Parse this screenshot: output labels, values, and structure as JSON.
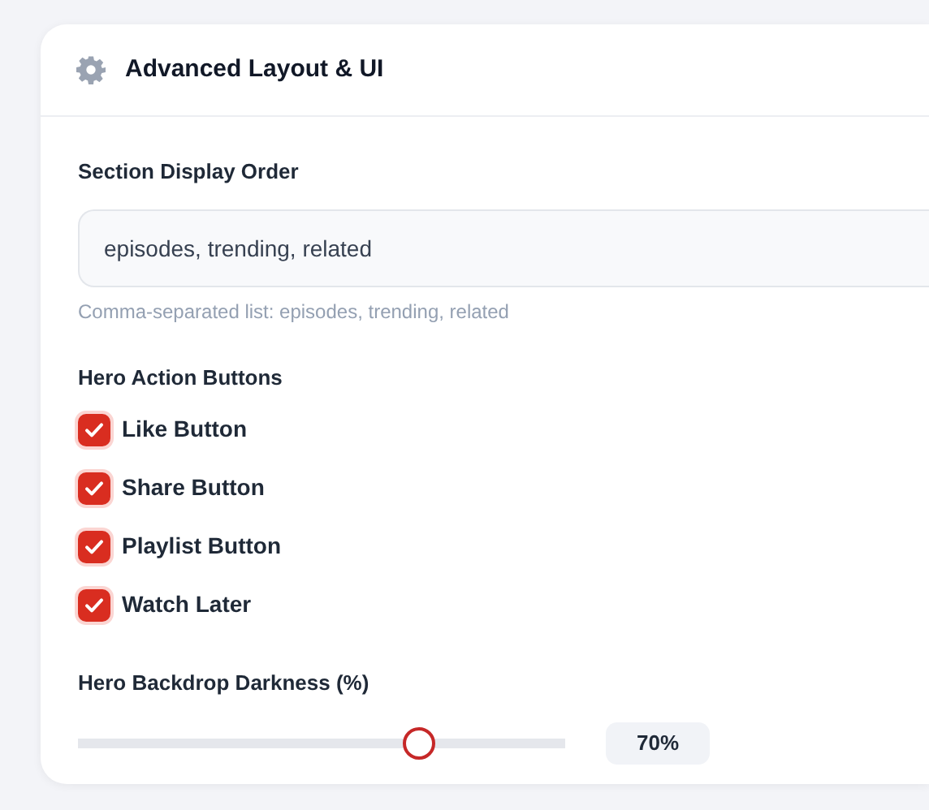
{
  "card": {
    "title": "Advanced Layout & UI"
  },
  "section_order": {
    "label": "Section Display Order",
    "value": "episodes, trending, related",
    "help": "Comma-separated list: episodes, trending, related"
  },
  "hero_buttons": {
    "label": "Hero Action Buttons",
    "items": [
      {
        "label": "Like Button",
        "checked": true
      },
      {
        "label": "Share Button",
        "checked": true
      },
      {
        "label": "Playlist Button",
        "checked": true
      },
      {
        "label": "Watch Later",
        "checked": true
      }
    ]
  },
  "darkness": {
    "label": "Hero Backdrop Darkness (%)",
    "level": 0.7,
    "reading": "70%"
  }
}
